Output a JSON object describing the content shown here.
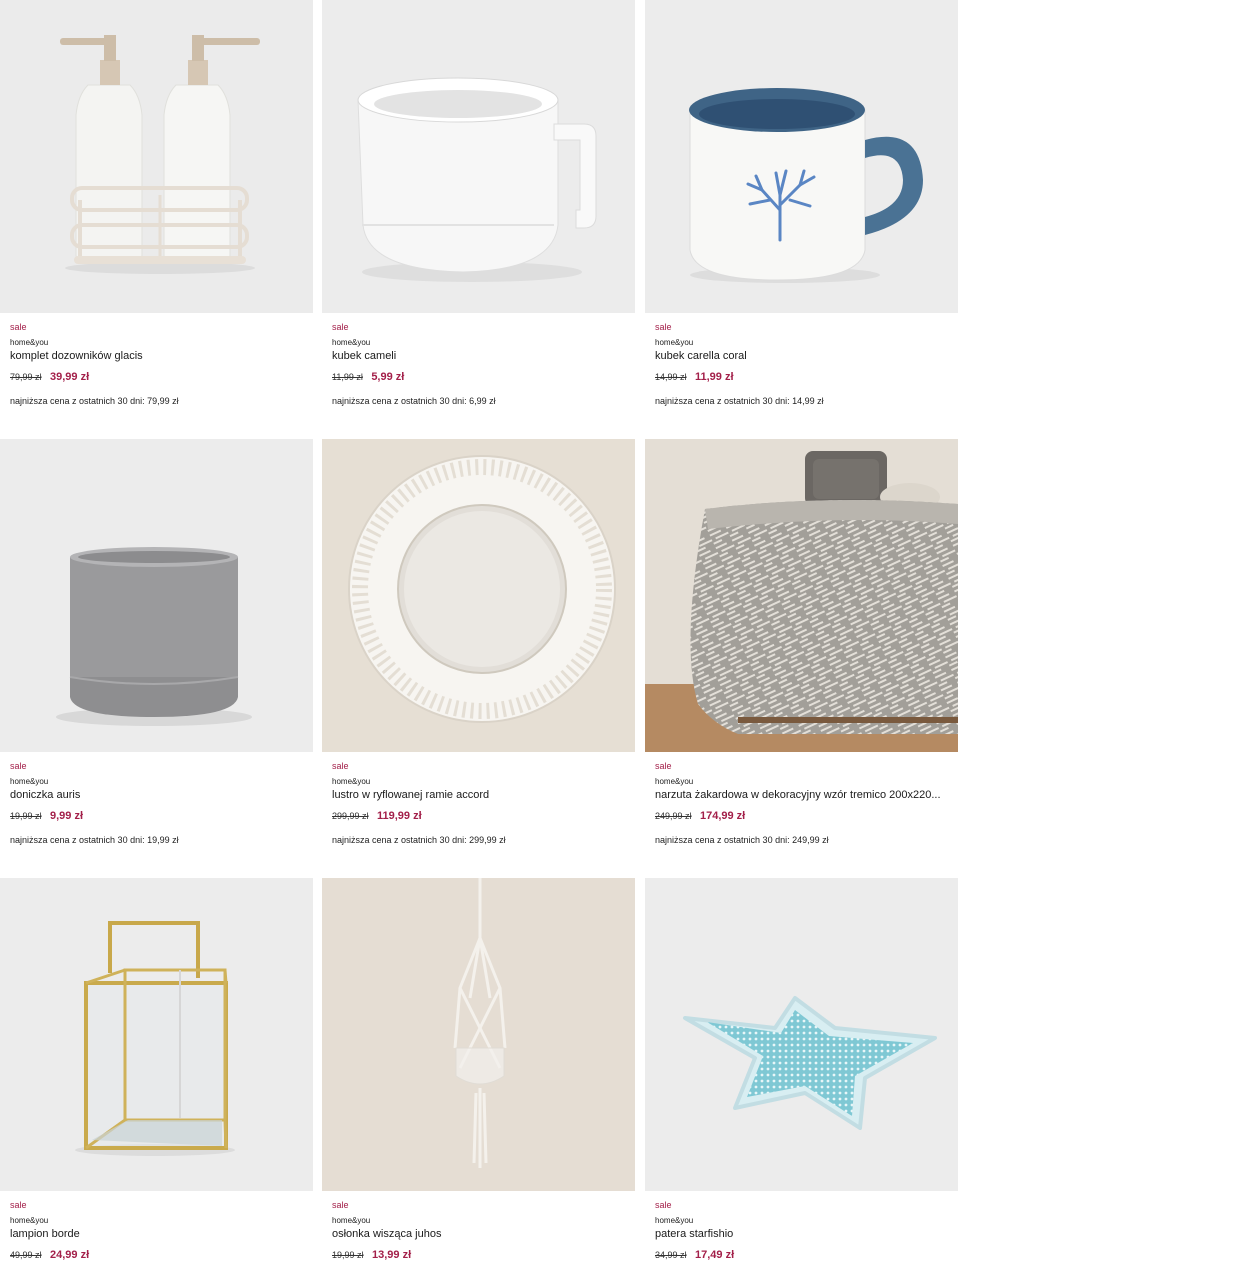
{
  "products": [
    {
      "badge": "sale",
      "brand": "home&you",
      "name": "komplet dozowników glacis",
      "old_price": "79,99 zł",
      "price": "39,99 zł",
      "lowest": "najniższa cena z ostatnich 30 dni: 79,99 zł",
      "image_icon": "soap-dispenser-set-icon"
    },
    {
      "badge": "sale",
      "brand": "home&you",
      "name": "kubek cameli",
      "old_price": "11,99 zł",
      "price": "5,99 zł",
      "lowest": "najniższa cena z ostatnich 30 dni: 6,99 zł",
      "image_icon": "white-mug-icon"
    },
    {
      "badge": "sale",
      "brand": "home&you",
      "name": "kubek carella coral",
      "old_price": "14,99 zł",
      "price": "11,99 zł",
      "lowest": "najniższa cena z ostatnich 30 dni: 14,99 zł",
      "image_icon": "coral-mug-icon"
    },
    {
      "badge": "sale",
      "brand": "home&you",
      "name": "doniczka auris",
      "old_price": "19,99 zł",
      "price": "9,99 zł",
      "lowest": "najniższa cena z ostatnich 30 dni: 19,99 zł",
      "image_icon": "flower-pot-icon"
    },
    {
      "badge": "sale",
      "brand": "home&you",
      "name": "lustro w ryflowanej ramie accord",
      "old_price": "299,99 zł",
      "price": "119,99 zł",
      "lowest": "najniższa cena z ostatnich 30 dni: 299,99 zł",
      "image_icon": "round-mirror-icon"
    },
    {
      "badge": "sale",
      "brand": "home&you",
      "name": "narzuta żakardowa w dekoracyjny wzór tremico 200x220...",
      "old_price": "249,99 zł",
      "price": "174,99 zł",
      "lowest": "najniższa cena z ostatnich 30 dni: 249,99 zł",
      "image_icon": "bedspread-icon"
    },
    {
      "badge": "sale",
      "brand": "home&you",
      "name": "lampion borde",
      "old_price": "49,99 zł",
      "price": "24,99 zł",
      "lowest": "",
      "image_icon": "lantern-icon"
    },
    {
      "badge": "sale",
      "brand": "home&you",
      "name": "osłonka wisząca juhos",
      "old_price": "19,99 zł",
      "price": "13,99 zł",
      "lowest": "",
      "image_icon": "hanging-planter-icon"
    },
    {
      "badge": "sale",
      "brand": "home&you",
      "name": "patera starfishio",
      "old_price": "34,99 zł",
      "price": "17,49 zł",
      "lowest": "",
      "image_icon": "starfish-plate-icon"
    }
  ],
  "colors": {
    "sale_accent": "#a3204a",
    "image_bg": "#eaeaea"
  }
}
